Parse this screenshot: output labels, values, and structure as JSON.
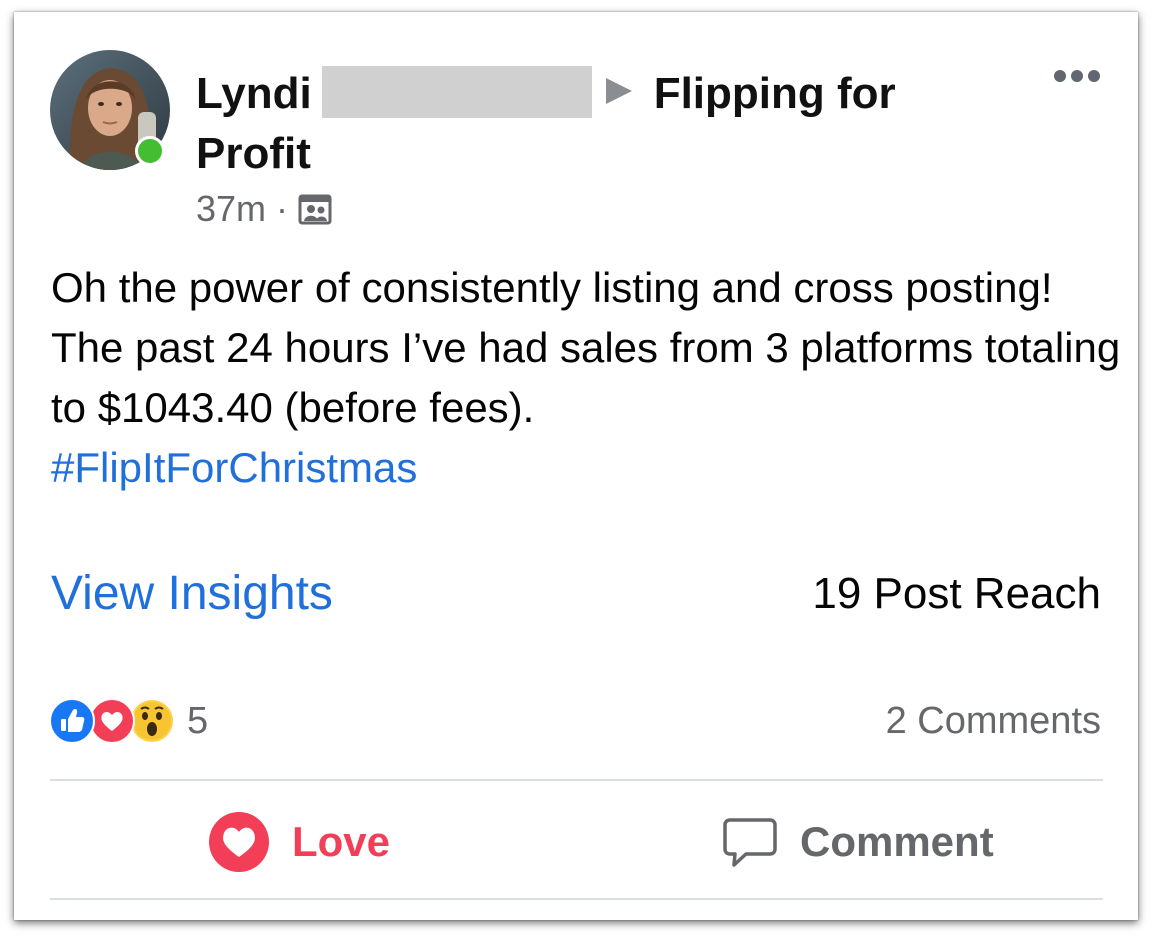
{
  "post": {
    "author_first_name": "Lyndi",
    "group_name": "Flipping for Profit",
    "timestamp": "37m",
    "separator": "·",
    "audience_icon": "group-audience-icon",
    "more_icon": "more-options-icon",
    "body": "Oh the power of consistently listing and cross posting! The past 24 hours I’ve had sales from 3 platforms totaling to $1043.40 (before fees).",
    "hashtag": "#FlipItForChristmas",
    "online": true
  },
  "insights": {
    "link_label": "View Insights",
    "reach_text": "19 Post Reach"
  },
  "reactions": {
    "icons": [
      "like-reaction-icon",
      "love-reaction-icon",
      "wow-reaction-icon"
    ],
    "count": "5",
    "comments_text": "2 Comments"
  },
  "actions": {
    "love_label": "Love",
    "love_icon": "heart-icon",
    "comment_label": "Comment",
    "comment_icon": "comment-bubble-icon"
  },
  "colors": {
    "link": "#216fdb",
    "love": "#f33e58",
    "online": "#44bd32",
    "muted": "#65676b",
    "like": "#1877f2"
  }
}
